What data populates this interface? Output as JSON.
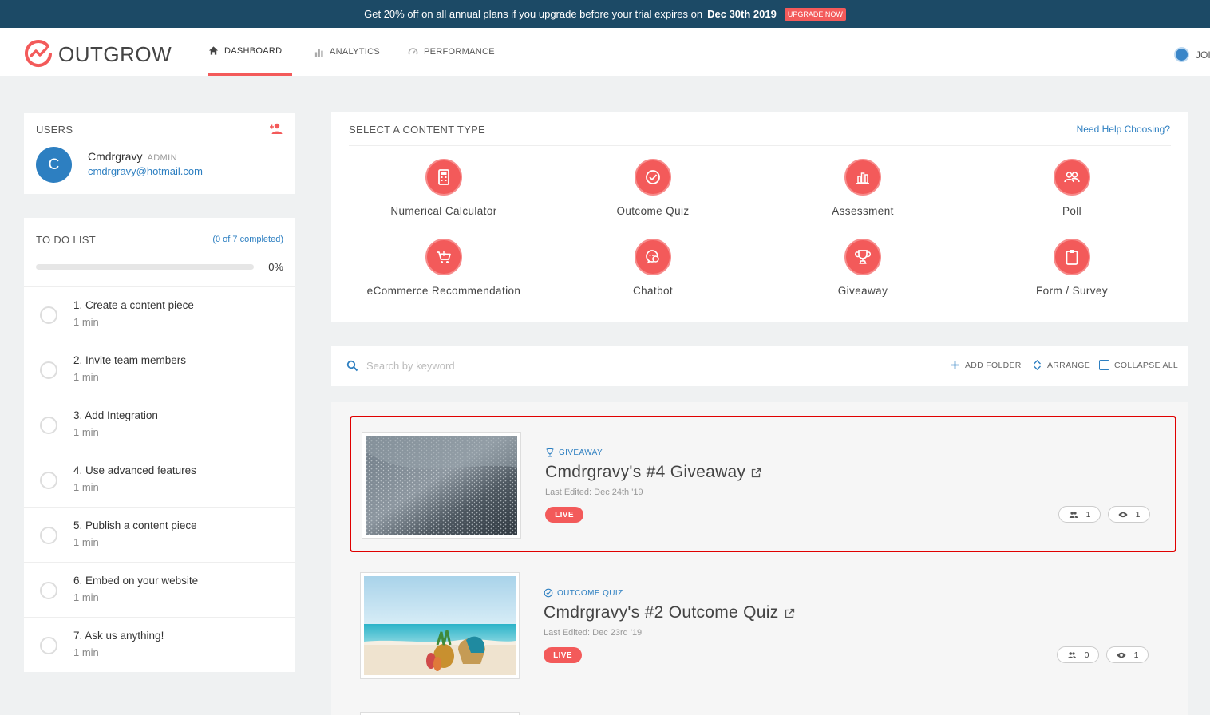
{
  "promo": {
    "text_before": "Get 20% off on all annual plans if you upgrade before your trial expires on",
    "date": "Dec 30th 2019",
    "button": "UPGRADE NOW"
  },
  "header": {
    "logo_text": "OUTGROW",
    "tabs": [
      {
        "label": "DASHBOARD",
        "icon": "home-icon",
        "active": true
      },
      {
        "label": "ANALYTICS",
        "icon": "bar-chart-icon",
        "active": false
      },
      {
        "label": "PERFORMANCE",
        "icon": "gauge-icon",
        "active": false
      }
    ],
    "user_label": "JOI"
  },
  "users": {
    "heading": "USERS",
    "avatar_initial": "C",
    "name": "Cmdrgravy",
    "role": "ADMIN",
    "email": "cmdrgravy@hotmail.com"
  },
  "todo": {
    "heading": "TO DO LIST",
    "progress_text": "(0 of 7 completed)",
    "progress_fraction": 0,
    "progress_label": "0%",
    "items": [
      {
        "title": "1. Create a content piece",
        "time": "1 min"
      },
      {
        "title": "2. Invite team members",
        "time": "1 min"
      },
      {
        "title": "3. Add Integration",
        "time": "1 min"
      },
      {
        "title": "4. Use advanced features",
        "time": "1 min"
      },
      {
        "title": "5. Publish a content piece",
        "time": "1 min"
      },
      {
        "title": "6. Embed on your website",
        "time": "1 min"
      },
      {
        "title": "7. Ask us anything!",
        "time": "1 min"
      }
    ]
  },
  "content_types": {
    "heading": "SELECT A CONTENT TYPE",
    "help_link": "Need Help Choosing?",
    "items": [
      {
        "label": "Numerical Calculator",
        "icon": "calculator-icon"
      },
      {
        "label": "Outcome Quiz",
        "icon": "check-circle-icon"
      },
      {
        "label": "Assessment",
        "icon": "bar-chart-icon"
      },
      {
        "label": "Poll",
        "icon": "users-icon"
      },
      {
        "label": "eCommerce Recommendation",
        "icon": "cart-icon"
      },
      {
        "label": "Chatbot",
        "icon": "chat-icon"
      },
      {
        "label": "Giveaway",
        "icon": "trophy-icon"
      },
      {
        "label": "Form / Survey",
        "icon": "clipboard-icon"
      }
    ],
    "accent_color": "#f35a5a"
  },
  "toolbar": {
    "search_placeholder": "Search by keyword",
    "add_folder": "ADD FOLDER",
    "arrange": "ARRANGE",
    "collapse_all": "COLLAPSE ALL"
  },
  "content_items": [
    {
      "type": "GIVEAWAY",
      "type_icon": "trophy-icon",
      "title": "Cmdrgravy's #4 Giveaway",
      "edited": "Last Edited: Dec 24th '19",
      "status": "LIVE",
      "users": "1",
      "views": "1",
      "highlighted": true
    },
    {
      "type": "OUTCOME QUIZ",
      "type_icon": "check-circle-icon",
      "title": "Cmdrgravy's #2 Outcome Quiz",
      "edited": "Last Edited: Dec 23rd '19",
      "status": "LIVE",
      "users": "0",
      "views": "1",
      "highlighted": false
    }
  ]
}
